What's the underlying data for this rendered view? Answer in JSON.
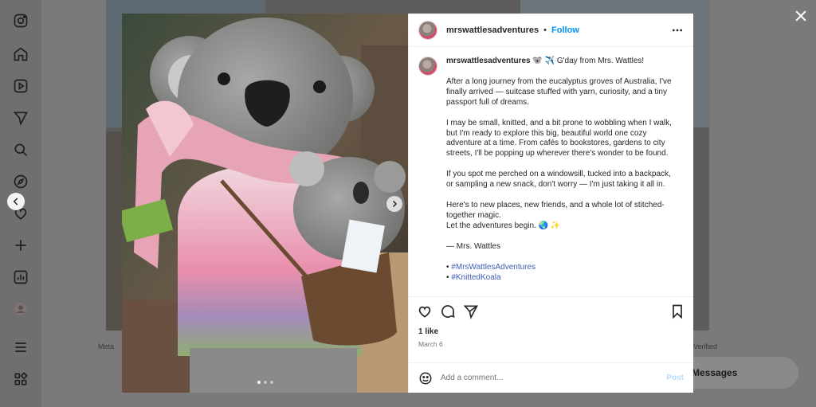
{
  "background": {
    "footer_left": "Meta",
    "footer_right": "Verified",
    "messages_label": "Messages"
  },
  "rail": {
    "icons": [
      "instagram-logo-icon",
      "home-icon",
      "reels-icon",
      "messages-icon",
      "search-icon",
      "explore-icon",
      "notifications-icon",
      "create-icon",
      "dashboard-icon",
      "profile-icon",
      "menu-icon",
      "more-apps-icon"
    ]
  },
  "post": {
    "username": "mrswattlesadventures",
    "separator": "•",
    "follow_label": "Follow",
    "caption": {
      "username": "mrswattlesadventures",
      "first_line": "🐨 ✈️ G'day from Mrs. Wattles!",
      "paragraphs": [
        "After a long journey from the eucalyptus groves of Australia, I've finally arrived — suitcase stuffed with yarn, curiosity, and a tiny passport full of dreams.",
        "I may be small, knitted, and a bit prone to wobbling when I walk, but I'm ready to explore this big, beautiful world one cozy adventure at a time. From cafés to bookstores, gardens to city streets, I'll be popping up wherever there's wonder to be found.",
        "If you spot me perched on a windowsill, tucked into a backpack, or sampling a new snack, don't worry — I'm just taking it all in."
      ],
      "closing_line1": "Here's to new places, new friends, and a whole lot of stitched-together magic.",
      "closing_line2": "Let the adventures begin. 🌏 ✨",
      "signature": "— Mrs. Wattles",
      "hashtags": [
        "#MrsWattlesAdventures",
        "#KnittedKoala"
      ],
      "bullet": "•"
    },
    "likes": "1 like",
    "date": "March 6",
    "comment_placeholder": "Add a comment...",
    "post_label": "Post",
    "carousel": {
      "total": 3,
      "current": 1
    }
  },
  "colors": {
    "accent": "#0095f6",
    "post_disabled": "#b3dbff",
    "hashtag": "#3f5cb4"
  }
}
